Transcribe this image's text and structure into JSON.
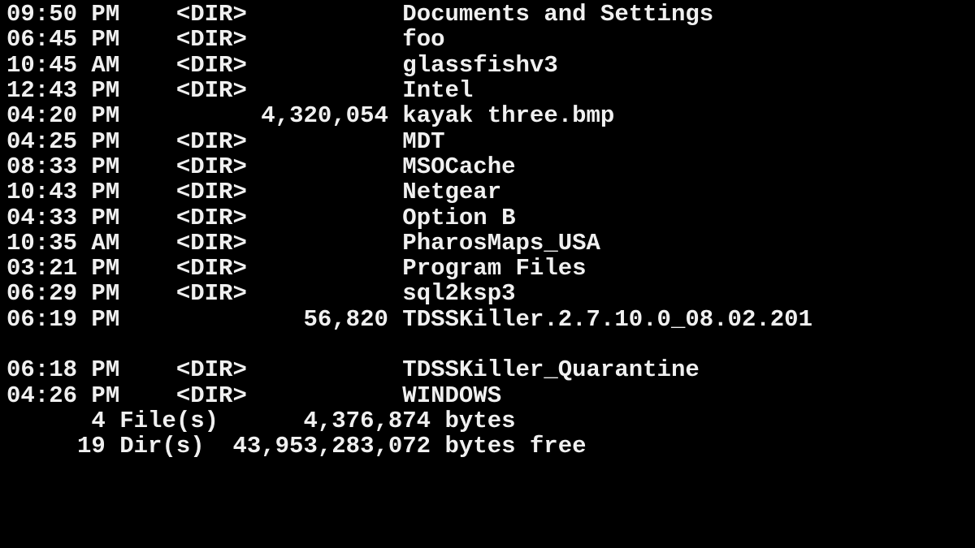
{
  "entries": [
    {
      "time": "09:50 PM",
      "type": "<DIR>",
      "size": "",
      "name": "Documents and Settings"
    },
    {
      "time": "06:45 PM",
      "type": "<DIR>",
      "size": "",
      "name": "foo"
    },
    {
      "time": "10:45 AM",
      "type": "<DIR>",
      "size": "",
      "name": "glassfishv3"
    },
    {
      "time": "12:43 PM",
      "type": "<DIR>",
      "size": "",
      "name": "Intel"
    },
    {
      "time": "04:20 PM",
      "type": "",
      "size": "4,320,054",
      "name": "kayak three.bmp"
    },
    {
      "time": "04:25 PM",
      "type": "<DIR>",
      "size": "",
      "name": "MDT"
    },
    {
      "time": "08:33 PM",
      "type": "<DIR>",
      "size": "",
      "name": "MSOCache"
    },
    {
      "time": "10:43 PM",
      "type": "<DIR>",
      "size": "",
      "name": "Netgear"
    },
    {
      "time": "04:33 PM",
      "type": "<DIR>",
      "size": "",
      "name": "Option B"
    },
    {
      "time": "10:35 AM",
      "type": "<DIR>",
      "size": "",
      "name": "PharosMaps_USA"
    },
    {
      "time": "03:21 PM",
      "type": "<DIR>",
      "size": "",
      "name": "Program Files"
    },
    {
      "time": "06:29 PM",
      "type": "<DIR>",
      "size": "",
      "name": "sql2ksp3"
    },
    {
      "time": "06:19 PM",
      "type": "",
      "size": "56,820",
      "name": "TDSSKiller.2.7.10.0_08.02.201"
    },
    {
      "time": "",
      "type": "",
      "size": "",
      "name": ""
    },
    {
      "time": "06:18 PM",
      "type": "<DIR>",
      "size": "",
      "name": "TDSSKiller_Quarantine"
    },
    {
      "time": "04:26 PM",
      "type": "<DIR>",
      "size": "",
      "name": "WINDOWS"
    }
  ],
  "summary": {
    "files_line": "      4 File(s)      4,376,874 bytes",
    "dirs_line": "     19 Dir(s)  43,953,283,072 bytes free"
  }
}
